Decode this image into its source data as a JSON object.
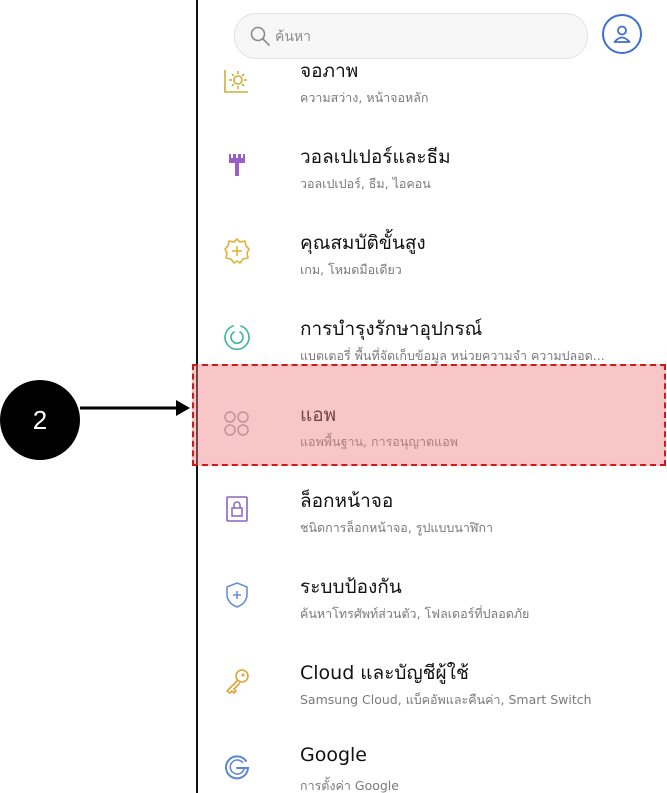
{
  "search": {
    "placeholder": "ค้นหา"
  },
  "items": [
    {
      "title": "จอภาพ",
      "subtitle": "ความสว่าง, หน้าจอหลัก",
      "icon": "display-brightness-icon"
    },
    {
      "title": "วอลเปเปอร์และธีม",
      "subtitle": "วอลเปเปอร์, ธีม, ไอคอน",
      "icon": "paintbrush-icon"
    },
    {
      "title": "คุณสมบัติขั้นสูง",
      "subtitle": "เกม, โหมดมือเดียว",
      "icon": "gear-plus-icon"
    },
    {
      "title": "การบำรุงรักษาอุปกรณ์",
      "subtitle": "แบตเตอรี่ พื้นที่จัดเก็บข้อมูล หน่วยความจำ ความปลอด...",
      "icon": "device-care-icon"
    },
    {
      "title": "แอพ",
      "subtitle": "แอพพื้นฐาน, การอนุญาตแอพ",
      "icon": "apps-grid-icon"
    },
    {
      "title": "ล็อกหน้าจอ",
      "subtitle": "ชนิดการล็อกหน้าจอ, รูปแบบนาฬิกา",
      "icon": "lock-screen-icon"
    },
    {
      "title": "ระบบป้องกัน",
      "subtitle": "ค้นหาโทรศัพท์ส่วนตัว, โฟลเดอร์ที่ปลอดภัย",
      "icon": "shield-icon"
    },
    {
      "title": "Cloud และบัญชีผู้ใช้",
      "subtitle": "Samsung Cloud, แบ็คอัพและคืนค่า, Smart Switch",
      "icon": "key-icon"
    },
    {
      "title": "Google",
      "subtitle": "การตั้งค่า Google",
      "icon": "google-icon"
    }
  ],
  "annotation": {
    "step_number": "2",
    "highlight_color": "#f08080",
    "border_color": "#d01a1a"
  }
}
